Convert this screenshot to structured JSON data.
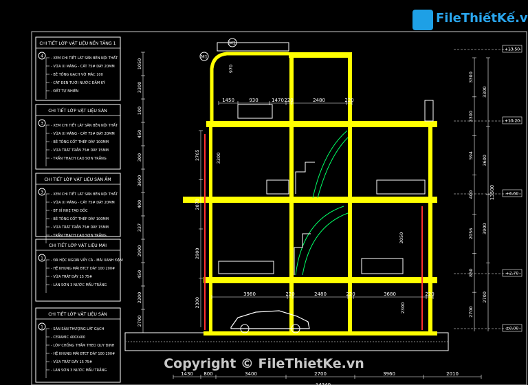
{
  "brand": {
    "logo_text": "FileThiếtKế.vn",
    "watermark": "Copyright © FileThietKe.vn"
  },
  "legend": {
    "sections": [
      {
        "title": "CHI TIẾT LỚP VẬT LIỆU NỀN TẦNG 1",
        "tag": "4",
        "items": [
          "XEM CHI TIẾT LÁT SÀN BÊN NỘI THẤT",
          "VỮA XI MĂNG - CÁT 75# DÀY 20MM",
          "BÊ TÔNG GẠCH VỠ MÁC 100",
          "CÁT ĐEN TƯỚI NƯỚC ĐẦM KỸ",
          "ĐẤT TỰ NHIÊN"
        ]
      },
      {
        "title": "CHI TIẾT LỚP VẬT LIỆU SÀN",
        "tag": "3",
        "items": [
          "XEM CHI TIẾT LÁT SÀN BÊN NỘI THẤT",
          "VỮA XI MĂNG - CÁT 75# DÀY 20MM",
          "BÊ TÔNG CỐT THÉP DÀY 100MM",
          "VỮA TRÁT TRẦN 75# DÀY 15MM",
          "TRẦN THẠCH CAO SƠN TRẮNG"
        ]
      },
      {
        "title": "CHI TIẾT LỚP VẬT LIỆU SÀN ẨM",
        "tag": "3",
        "items": [
          "XEM CHI TIẾT LÁT SÀN BÊN NỘI THẤT",
          "VỮA XI MĂNG - CÁT 75# DÀY 20MM",
          "BT XỈ NHẸ TẠO DỐC",
          "BÊ TÔNG CỐT THÉP DÀY 100MM",
          "VỮA TRÁT TRẦN 75# DÀY 15MM",
          "TRẦN THẠCH CAO SƠN TRẮNG"
        ]
      },
      {
        "title": "CHI TIẾT LỚP VẬT LIỆU MÁI",
        "tag": "1",
        "items": [
          "ĐÁ HỘC NGOÀI VẨY CÁ - MÁI XANH ĐẬM",
          "HỆ KHUNG MÁI BTCT DÀY 100 200#",
          "VỮA TRÁT DÀY 15 75#",
          "LÁN SƠN 3 NƯỚC MẦU TRẮNG"
        ]
      },
      {
        "title": "CHI TIẾT LỚP VẬT LIỆU SÀN",
        "tag": "1",
        "items": [
          "SÀN SÂN THƯỢNG LÁT GẠCH",
          "CERAMIC 400X400",
          "LỚP CHỐNG THẤM THEO QUY ĐỊNH",
          "HỆ KHUNG MÁI BTCT DÀY 100 200#",
          "VỮA TRÁT DÀY 15 75#",
          "LÁN SƠN 3 NƯỚC MẦU TRẮNG"
        ]
      }
    ]
  },
  "levels": [
    "+13.50",
    "+10.20",
    "+6.60",
    "+2.70",
    "±0.00"
  ],
  "total_height": "13500",
  "dims_top": [
    "1450",
    "930",
    "1470",
    "220",
    "2480",
    "220"
  ],
  "dims_mid": [
    "3980",
    "220",
    "2480",
    "220",
    "3680",
    "220"
  ],
  "dims_bottom": [
    "1430",
    "800",
    "3400",
    "2700",
    "3960",
    "2010"
  ],
  "dims_overall": "14240",
  "left_dims_outer": [
    "1050",
    "3300",
    "100",
    "450",
    "300",
    "3600",
    "400",
    "337",
    "2900",
    "450",
    "2200",
    "2700"
  ],
  "left_dims_inner": [
    "2765",
    "2878",
    "2900",
    "2300"
  ],
  "right_dims_a": [
    "3300",
    "3300",
    "594",
    "400",
    "2056",
    "850",
    "2700"
  ],
  "right_dims_b": [
    "3300",
    "3600",
    "3900",
    "2700"
  ],
  "markers": {
    "m1": "M1",
    "m2": "M1"
  },
  "inner_labels": [
    "970",
    "3300",
    "2050",
    "2300"
  ]
}
